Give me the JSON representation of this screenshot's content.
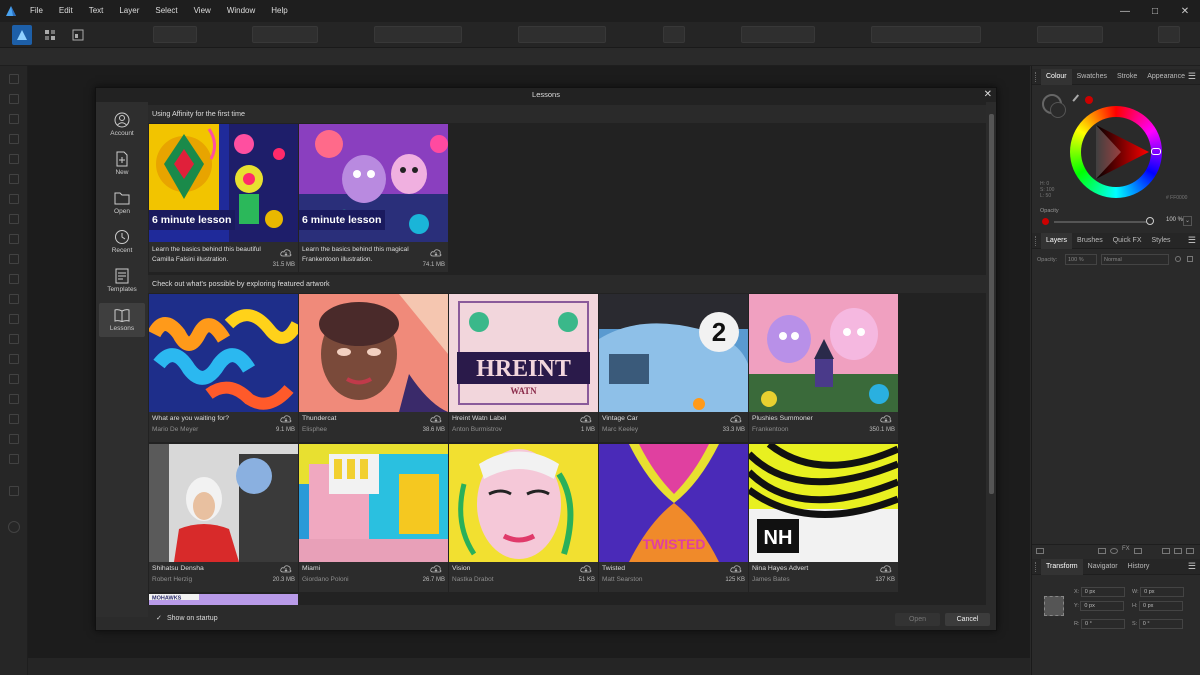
{
  "menubar": {
    "items": [
      "File",
      "Edit",
      "Text",
      "Layer",
      "Select",
      "View",
      "Window",
      "Help"
    ]
  },
  "dialog": {
    "title": "Lessons",
    "sidebar": [
      {
        "label": "Account",
        "icon": "account-icon"
      },
      {
        "label": "New",
        "icon": "new-document-icon"
      },
      {
        "label": "Open",
        "icon": "folder-icon"
      },
      {
        "label": "Recent",
        "icon": "recent-clock-icon"
      },
      {
        "label": "Templates",
        "icon": "templates-icon"
      },
      {
        "label": "Lessons",
        "icon": "lessons-book-icon"
      }
    ],
    "section1": "Using Affinity for the first time",
    "section2": "Check out what's possible by exploring featured artwork",
    "lessons": [
      {
        "badge": "6 minute lesson",
        "desc": "Learn the basics behind this beautiful Camilla Falsini illustration.",
        "size": "31.5 MB"
      },
      {
        "badge": "6 minute lesson",
        "desc": "Learn the basics behind this magical Frankentoon illustration.",
        "size": "74.1 MB"
      }
    ],
    "artworks": [
      {
        "title": "What are you waiting for?",
        "author": "Mario De Meyer",
        "size": "9.1 MB"
      },
      {
        "title": "Thundercat",
        "author": "Elisphee",
        "size": "38.6 MB"
      },
      {
        "title": "Hreint Watn Label",
        "author": "Anton Burmistrov",
        "size": "1 MB"
      },
      {
        "title": "Vintage Car",
        "author": "Marc Keeley",
        "size": "33.3 MB"
      },
      {
        "title": "Plushies Summoner",
        "author": "Frankentoon",
        "size": "350.1 MB"
      },
      {
        "title": "Shihatsu Densha",
        "author": "Robert Herzig",
        "size": "20.3 MB"
      },
      {
        "title": "Miami",
        "author": "Giordano Poloni",
        "size": "26.7 MB"
      },
      {
        "title": "Vision",
        "author": "Nastka Drabot",
        "size": "51 KB"
      },
      {
        "title": "Twisted",
        "author": "Matt Searston",
        "size": "125 KB"
      },
      {
        "title": "Nina Hayes Advert",
        "author": "James Bates",
        "size": "137 KB"
      }
    ],
    "thumb_texts": {
      "hreint": "HREINT",
      "watn": "WATN",
      "car_number": "2",
      "nh": "NH",
      "mohawks": "MOHAWKS",
      "twisted": "TWISTED"
    },
    "footer": {
      "show_on_startup": "Show on startup",
      "checked": true,
      "open": "Open",
      "cancel": "Cancel"
    }
  },
  "right_panel": {
    "colour_tabs": [
      "Colour",
      "Swatches",
      "Stroke",
      "Appearance"
    ],
    "opacity_label": "Opacity",
    "opacity_value": "100 %",
    "hex_value": "FF0000",
    "layer_tabs": [
      "Layers",
      "Brushes",
      "Quick FX",
      "Styles"
    ],
    "layer_opacity_label": "Opacity:",
    "layer_opacity_value": "100 %",
    "blend_mode": "Normal",
    "transform_tabs": [
      "Transform",
      "Navigator",
      "History"
    ],
    "transform": {
      "x": "0 px",
      "y": "0 px",
      "w": "0 px",
      "h": "0 px",
      "r": "0 °",
      "s": "0 °"
    }
  },
  "colors": {
    "accent": "#3a7bd5",
    "badge_bg": "#1a1a5e",
    "wheel_red": "#ff0000"
  }
}
